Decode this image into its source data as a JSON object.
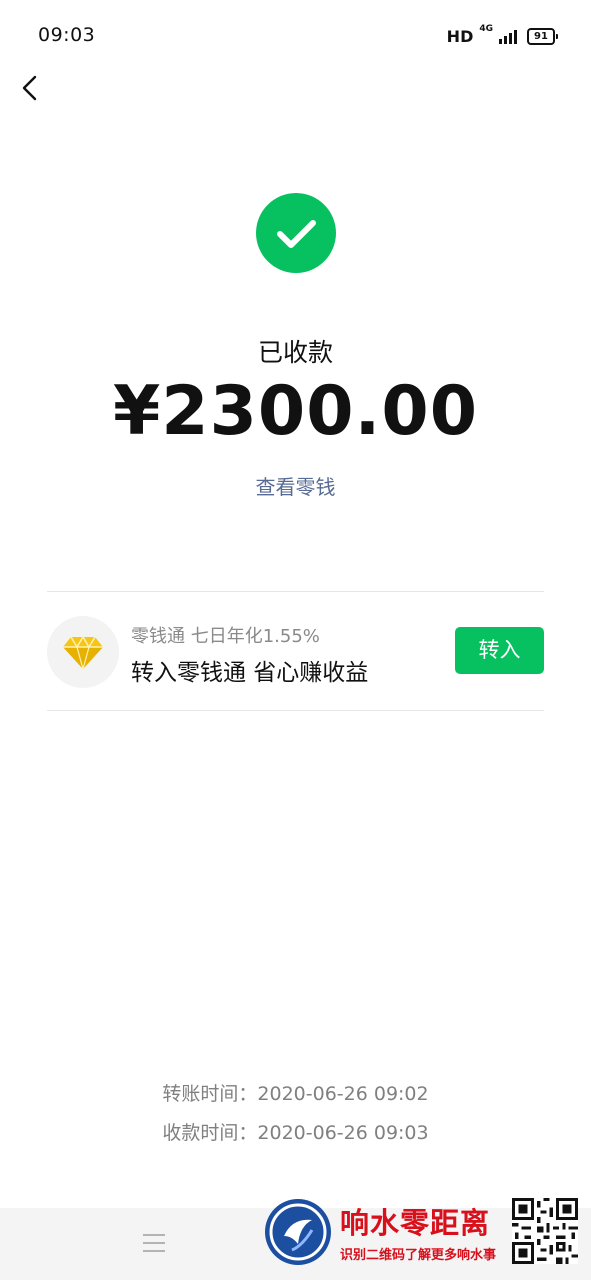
{
  "status_bar": {
    "time": "09:03",
    "hd": "HD",
    "network": "4G",
    "battery": "91"
  },
  "header": {
    "back_icon": "chevron-left-icon"
  },
  "result": {
    "icon": "check-circle-icon",
    "status": "已收款",
    "amount": "¥2300.00",
    "view_change_link": "查看零钱"
  },
  "promo": {
    "icon": "diamond-icon",
    "subtitle": "零钱通 七日年化1.55%",
    "title": "转入零钱通 省心赚收益",
    "button_label": "转入"
  },
  "details": {
    "transfer_time": "转账时间：2020-06-26 09:02",
    "receive_time": "收款时间：2020-06-26 09:03"
  },
  "nav": {
    "menu_icon": "menu-icon"
  },
  "watermark": {
    "title": "响水零距离",
    "subtitle": "识别二维码了解更多响水事"
  },
  "colors": {
    "accent": "#07c160",
    "link": "#576b95",
    "watermark": "#d8101c",
    "diamond": "#f5c518"
  }
}
